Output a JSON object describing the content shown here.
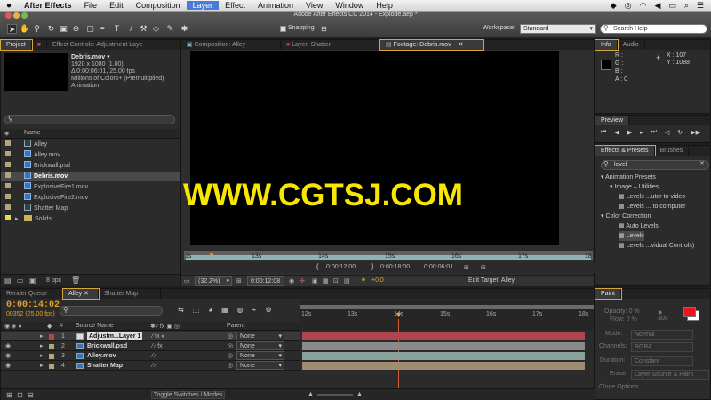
{
  "menubar": {
    "apple": "",
    "items": [
      "After Effects",
      "File",
      "Edit",
      "Composition",
      "Layer",
      "Effect",
      "Animation",
      "View",
      "Window",
      "Help"
    ],
    "active": "Layer"
  },
  "window_title": "Adobe After Effects CC 2014 - Explode.aep *",
  "toolbar": {
    "snapping_label": "Snapping",
    "workspace_label": "Workspace:",
    "workspace_value": "Standard",
    "search_help_placeholder": "Search Help"
  },
  "project_panel": {
    "tabs": [
      "Project",
      "Effect Controls: Adjustment Laye"
    ],
    "preview": {
      "name": "Debris.mov ▾",
      "line1": "1920 x 1080 (1.00)",
      "line2": "Δ 0:00:06:01, 25.00 fps",
      "line3": "Millions of Colors+ (Premultiplied)",
      "line4": "Animation"
    },
    "column_name": "Name",
    "items": [
      {
        "label": "Alley",
        "type": "comp",
        "swatch": "#b5a57a"
      },
      {
        "label": "Alley.mov",
        "type": "file",
        "swatch": "#b5a57a"
      },
      {
        "label": "Brickwall.psd",
        "type": "file",
        "swatch": "#b5a57a"
      },
      {
        "label": "Debris.mov",
        "type": "file",
        "swatch": "#b5a57a",
        "selected": true
      },
      {
        "label": "ExplosiveFire1.mov",
        "type": "file",
        "swatch": "#b5a57a"
      },
      {
        "label": "ExplosiveFire2.mov",
        "type": "file",
        "swatch": "#b5a57a"
      },
      {
        "label": "Shatter Map",
        "type": "comp",
        "swatch": "#b5a57a"
      },
      {
        "label": "Solids",
        "type": "folder",
        "swatch": "#e8d84a"
      }
    ],
    "bpc": "8 bpc"
  },
  "viewer": {
    "tabs": [
      "Composition: Alley",
      "Layer: Shatter",
      "Footage: Debris.mov"
    ],
    "ruler_labels": [
      "1s",
      "13s",
      "14s",
      "15s",
      "16s",
      "17s",
      "18"
    ],
    "in_point": "0:00:12:00",
    "out_point": "0:00:18:00",
    "duration": "0:00:06:01",
    "zoom": "(32.2%)",
    "current_time": "0:00:12:08",
    "exposure": "+0.0",
    "edit_target": "Edit Target: Alley"
  },
  "watermark": "WWW.CGTSJ.COM",
  "info_panel": {
    "tabs": [
      "Info",
      "Audio"
    ],
    "rgba": "R :\nG :\nB :\nA : 0",
    "x": "X : 107",
    "y": "Y : 1088"
  },
  "preview_panel": {
    "title": "Preview"
  },
  "effects_panel": {
    "tabs": [
      "Effects & Presets",
      "Brushes"
    ],
    "search_value": "level",
    "tree": [
      {
        "label": "Animation Presets",
        "level": 0
      },
      {
        "label": "Image – Utilities",
        "level": 1
      },
      {
        "label": "Levels ...uter to video",
        "level": 2
      },
      {
        "label": "Levels ... to computer",
        "level": 2
      },
      {
        "label": "Color Correction",
        "level": 0
      },
      {
        "label": "Auto Levels",
        "level": 2
      },
      {
        "label": "Levels",
        "level": 2,
        "selected": true
      },
      {
        "label": "Levels ...vidual Controls)",
        "level": 2
      }
    ]
  },
  "timeline": {
    "tabs": [
      "Render Queue",
      "Alley",
      "Shatter Map"
    ],
    "current_time": "0:00:14:02",
    "frame_info": "00352 (25.00 fps)",
    "col_source": "Source Name",
    "col_parent": "Parent",
    "ruler_labels": [
      "12s",
      "13s",
      "14s",
      "15s",
      "16s",
      "17s",
      "18s"
    ],
    "layers": [
      {
        "num": "1",
        "name": "Adjustm...Layer 1",
        "color": "#b8434f",
        "parent": "None",
        "bar": "#b04550"
      },
      {
        "num": "2",
        "name": "Brickwall.psd",
        "color": "#b5a57a",
        "parent": "None",
        "bar": "#8a8a8a"
      },
      {
        "num": "3",
        "name": "Alley.mov",
        "color": "#b5a57a",
        "parent": "None",
        "bar": "#8aa39a"
      },
      {
        "num": "4",
        "name": "Shatter Map",
        "color": "#b5a57a",
        "parent": "None",
        "bar": "#a08c70"
      }
    ],
    "footer": "Toggle Switches / Modes"
  },
  "paint_panel": {
    "title": "Paint",
    "opacity": "Opacity: 0 %",
    "flow": "Flow: 0 %",
    "size": "300",
    "mode_label": "Mode:",
    "mode_value": "Normal",
    "channels_label": "Channels:",
    "channels_value": "RGBA",
    "duration_label": "Duration:",
    "duration_value": "Constant",
    "erase_label": "Erase:",
    "erase_value": "Layer Source & Paint",
    "clone_label": "Clone Options",
    "fg_color": "#e8141e",
    "bg_color": "#ffffff"
  },
  "colors": {
    "accent_orange": "#e0a030",
    "selection": "#4a4a4a",
    "time_blue": "#4a9ae6",
    "watermark": "#f7e600"
  }
}
